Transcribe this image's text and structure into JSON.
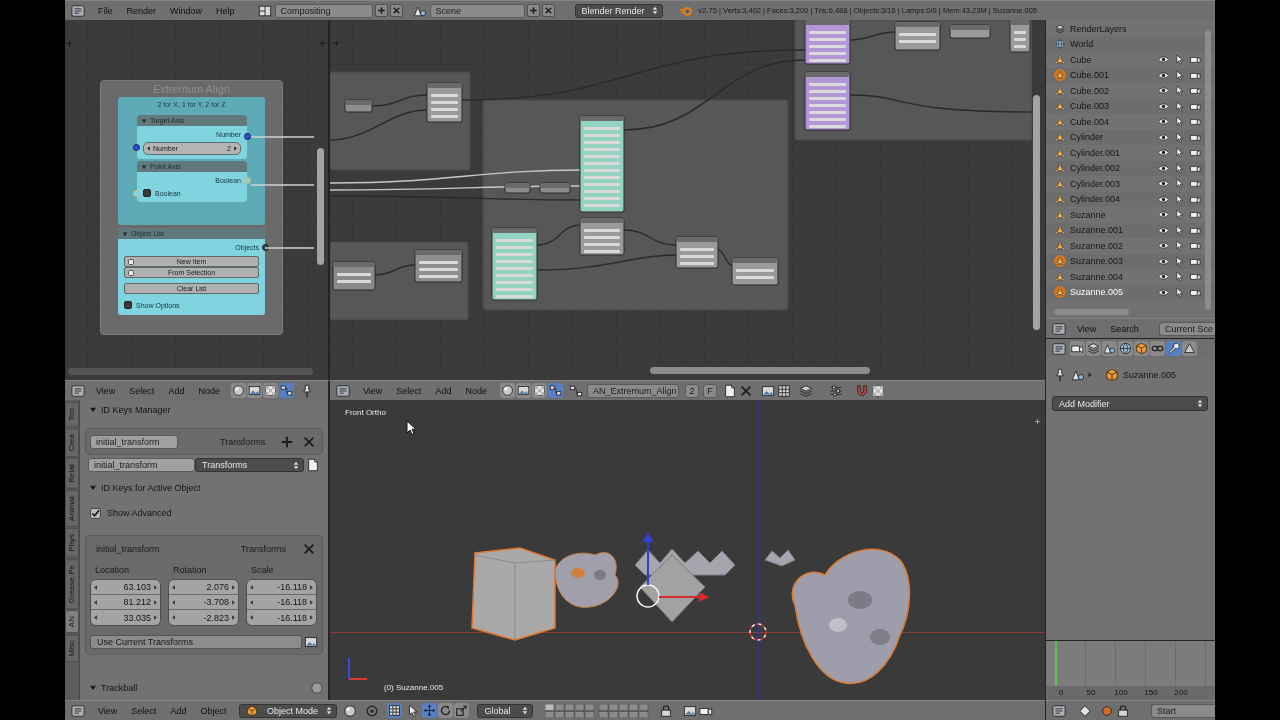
{
  "info_header": {
    "menus": [
      "File",
      "Render",
      "Window",
      "Help"
    ],
    "screen_layout": "Compositing",
    "scene": "Scene",
    "render_engine": "Blender Render",
    "stats": "v2.75 | Verts:3,402 | Faces:3,200 | Tris:6,488 | Objects:3/16 | Lamps:0/0 | Mem:43.23M | Suzanne.005"
  },
  "left_node_editor": {
    "frame": {
      "title": "Extremum Align",
      "label": "2 for X, 1 for Y, 2 for Z"
    },
    "target_axis_node": {
      "title": "Target Axis",
      "output": "Number",
      "field_label": "Number",
      "field_value": "2"
    },
    "point_axis_node": {
      "title": "Point Axis",
      "output": "Boolean",
      "input_label": "Boolean",
      "checked": false
    },
    "object_list_node": {
      "title": "Object List",
      "output": "Objects",
      "buttons": [
        "New Item",
        "From Selection",
        "Clear List"
      ],
      "option_label": "Show Options",
      "checked": false
    }
  },
  "left_node_header": {
    "menus": [
      "View",
      "Select",
      "Add",
      "Node"
    ],
    "tree_types": [
      {
        "selected": false
      },
      {
        "selected": false
      },
      {
        "selected": false
      },
      {
        "selected": true
      }
    ]
  },
  "right_node_header": {
    "menus": [
      "View",
      "Select",
      "Add",
      "Node"
    ],
    "tree_types": [
      {
        "selected": false
      },
      {
        "selected": false
      },
      {
        "selected": false
      },
      {
        "selected": true
      }
    ],
    "node_tree": "AN_Extremum_Align",
    "users": "2",
    "fake_user": "F"
  },
  "tool_shelf": {
    "tabs": [
      {
        "label": "Too",
        "selected": false
      },
      {
        "label": "Crea",
        "selected": false
      },
      {
        "label": "Relat",
        "selected": false
      },
      {
        "label": "Animat",
        "selected": false
      },
      {
        "label": "Phys",
        "selected": false
      },
      {
        "label": "Grease Pe",
        "selected": false
      },
      {
        "label": "AN",
        "selected": true
      },
      {
        "label": "Misc",
        "selected": false
      }
    ],
    "id_keys_manager": {
      "title": "ID Keys Manager",
      "expanded": true,
      "key_name": "initial_transform",
      "key_type": "Transforms",
      "new_key_name": "initial_transform",
      "new_key_type": "Transforms"
    },
    "active_object_keys": {
      "title": "ID Keys for Active Object",
      "expanded": true,
      "show_advanced": {
        "label": "Show Advanced",
        "checked": true
      },
      "key_name": "initial_transform",
      "key_type": "Transforms",
      "columns": [
        {
          "label": "Location",
          "values": [
            "63.103",
            "81.212",
            "33.035"
          ]
        },
        {
          "label": "Rotation",
          "values": [
            "2.076",
            "-3.708",
            "-2.823"
          ]
        },
        {
          "label": "Scale",
          "values": [
            "-16.118",
            "-16.118",
            "-16.118"
          ]
        }
      ],
      "apply_button": "Use Current Transforms"
    },
    "trackball": {
      "title": "Trackball",
      "expanded": true
    }
  },
  "viewport": {
    "view_name": "Front Ortho",
    "object_info": "(0) Suzanne.005"
  },
  "viewport_header": {
    "menus": [
      "View",
      "Select",
      "Add",
      "Object"
    ],
    "mode": "Object Mode",
    "manipulator_on": true,
    "orientation": "Global",
    "transform_tools": [
      {
        "selected": true
      },
      {
        "selected": false
      },
      {
        "selected": false
      }
    ]
  },
  "outliner": {
    "items": [
      {
        "kind": "render_layers",
        "name": "RenderLayers",
        "selected": false,
        "active": false
      },
      {
        "kind": "world",
        "name": "World",
        "selected": false,
        "active": false
      },
      {
        "kind": "object",
        "name": "Cube",
        "selected": false,
        "active": false
      },
      {
        "kind": "object",
        "name": "Cube.001",
        "selected": true,
        "active": false
      },
      {
        "kind": "object",
        "name": "Cube.002",
        "selected": false,
        "active": false
      },
      {
        "kind": "object",
        "name": "Cube.003",
        "selected": false,
        "active": false
      },
      {
        "kind": "object",
        "name": "Cube.004",
        "selected": false,
        "active": false
      },
      {
        "kind": "object",
        "name": "Cylinder",
        "selected": false,
        "active": false
      },
      {
        "kind": "object",
        "name": "Cylinder.001",
        "selected": false,
        "active": false
      },
      {
        "kind": "object",
        "name": "Cylinder.002",
        "selected": false,
        "active": false
      },
      {
        "kind": "object",
        "name": "Cylinder.003",
        "selected": false,
        "active": false
      },
      {
        "kind": "object",
        "name": "Cylinder.004",
        "selected": false,
        "active": false
      },
      {
        "kind": "object",
        "name": "Suzanne",
        "selected": false,
        "active": false
      },
      {
        "kind": "object",
        "name": "Suzanne.001",
        "selected": false,
        "active": false
      },
      {
        "kind": "object",
        "name": "Suzanne.002",
        "selected": false,
        "active": false
      },
      {
        "kind": "object",
        "name": "Suzanne.003",
        "selected": true,
        "active": false
      },
      {
        "kind": "object",
        "name": "Suzanne.004",
        "selected": false,
        "active": false
      },
      {
        "kind": "object",
        "name": "Suzanne.005",
        "selected": true,
        "active": true
      }
    ]
  },
  "outliner_header": {
    "menus": [
      "View",
      "Search"
    ],
    "display_mode": "Current Sce"
  },
  "properties": {
    "context_tabs": [
      {
        "selected": false
      },
      {
        "selected": false
      },
      {
        "selected": false
      },
      {
        "selected": false
      },
      {
        "selected": false
      },
      {
        "selected": false
      },
      {
        "selected": true
      },
      {
        "selected": false
      }
    ],
    "object_name": "Suzanne.005",
    "add_modifier": "Add Modifier"
  },
  "timeline": {
    "ruler": [
      "0",
      "50",
      "100",
      "150",
      "200"
    ]
  },
  "timeline_header": {
    "start_field": "Start"
  }
}
